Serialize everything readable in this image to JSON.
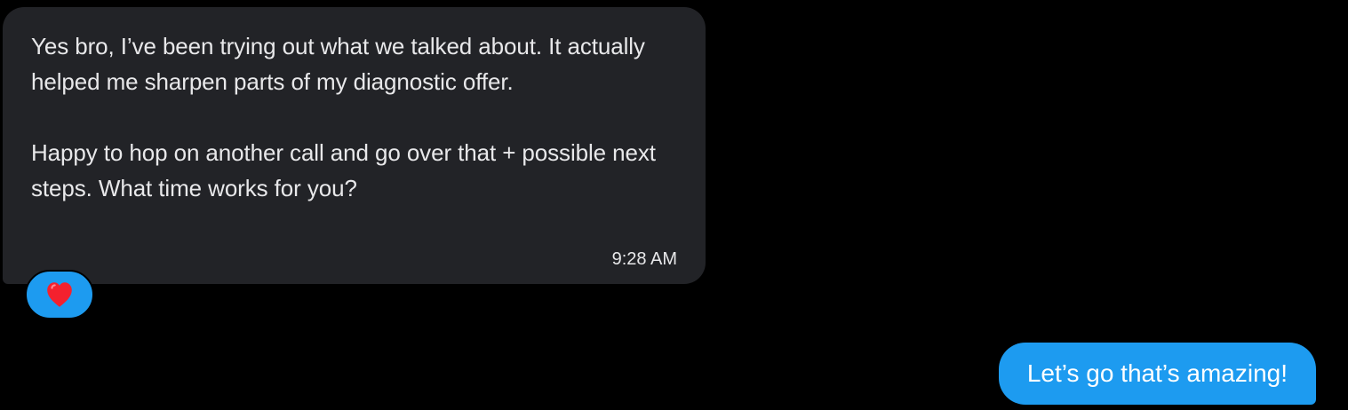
{
  "messages": [
    {
      "direction": "received",
      "paragraphs": [
        "Yes bro, I’ve been trying out what we talked about. It actually helped me sharpen parts of my diagnostic offer.",
        "Happy to hop on another call and go over that + possible next steps. What time works for you?"
      ],
      "time": "9:28 AM",
      "reaction": {
        "icon": "heart-icon",
        "emoji": "❤️",
        "color": "#f4212e"
      }
    },
    {
      "direction": "sent",
      "text": "Let’s go that’s amazing!"
    }
  ],
  "colors": {
    "background": "#000000",
    "received_bubble": "#222327",
    "sent_bubble": "#1d9bf0",
    "reaction_bubble": "#1d9bf0"
  }
}
